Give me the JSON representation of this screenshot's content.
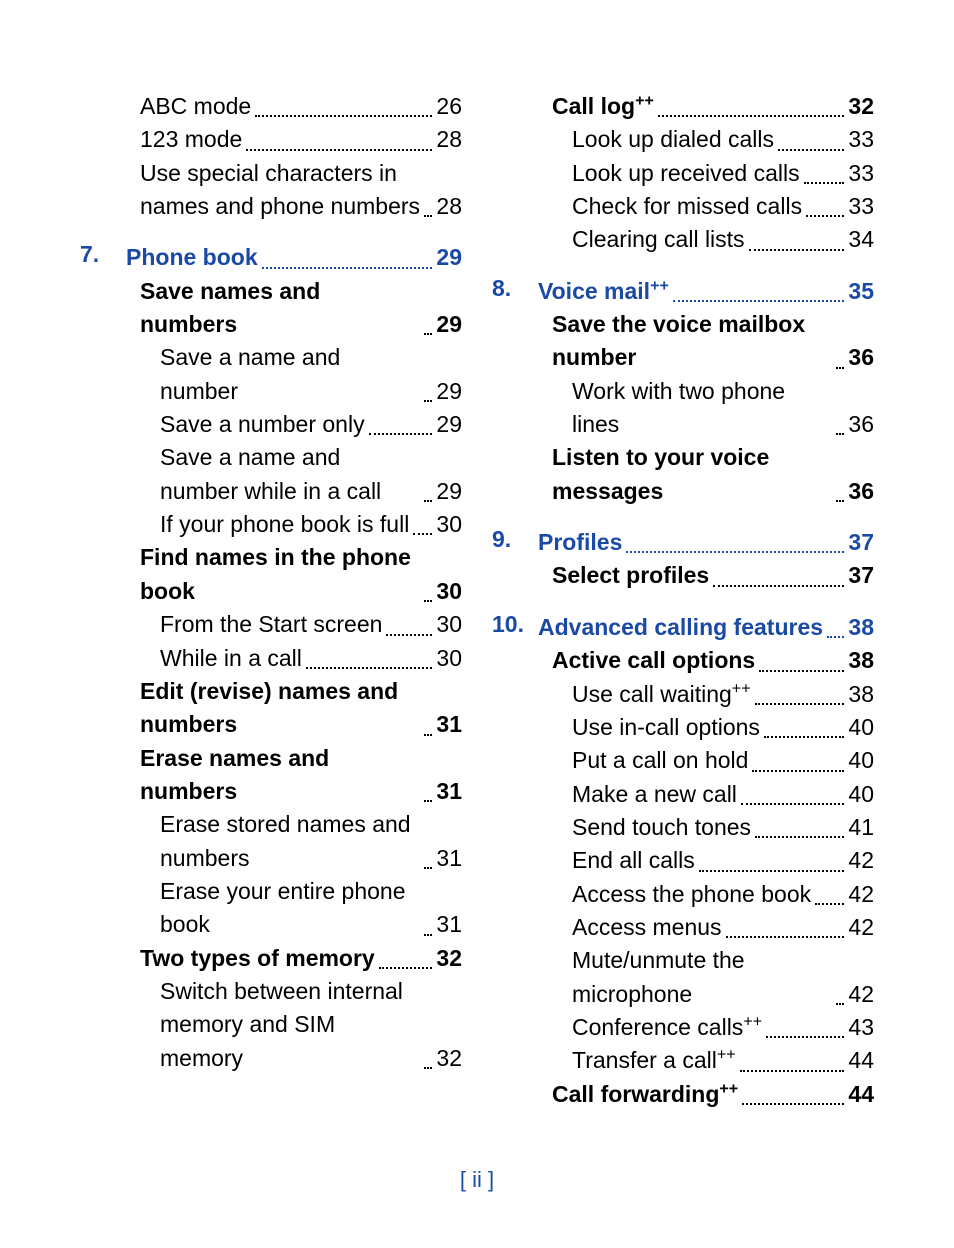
{
  "page_folio": "[ ii ]",
  "columns": [
    [
      {
        "level": 1,
        "style": "plain",
        "text": "ABC mode",
        "page": "26"
      },
      {
        "level": 1,
        "style": "plain",
        "text": "123 mode",
        "page": "28"
      },
      {
        "level": 1,
        "style": "plain",
        "text": "Use special characters in names and phone numbers",
        "page": "28"
      },
      {
        "level": 0,
        "style": "chapter",
        "num": "7.",
        "text": "Phone book",
        "page": "29"
      },
      {
        "level": 1,
        "style": "bold",
        "text": "Save names and numbers",
        "page": "29"
      },
      {
        "level": 2,
        "style": "plain",
        "text": "Save a name and number",
        "page": "29"
      },
      {
        "level": 2,
        "style": "plain",
        "text": "Save a number only",
        "page": "29"
      },
      {
        "level": 2,
        "style": "plain",
        "text": "Save a name and number while in a call",
        "page": "29"
      },
      {
        "level": 2,
        "style": "plain",
        "text": "If your phone book is full",
        "page": "30"
      },
      {
        "level": 1,
        "style": "bold",
        "text": "Find names in the phone book",
        "page": "30"
      },
      {
        "level": 2,
        "style": "plain",
        "text": "From the Start screen",
        "page": "30"
      },
      {
        "level": 2,
        "style": "plain",
        "text": "While in a call",
        "page": "30"
      },
      {
        "level": 1,
        "style": "bold",
        "text": "Edit (revise) names and numbers",
        "page": "31"
      },
      {
        "level": 1,
        "style": "bold",
        "text": "Erase names and numbers",
        "page": "31"
      },
      {
        "level": 2,
        "style": "plain",
        "text": "Erase stored names and numbers",
        "page": "31"
      },
      {
        "level": 2,
        "style": "plain",
        "text": "Erase your entire phone book",
        "page": "31"
      },
      {
        "level": 1,
        "style": "bold",
        "text": "Two types of memory",
        "page": "32"
      },
      {
        "level": 2,
        "style": "plain",
        "text": "Switch between internal memory and SIM memory",
        "page": "32"
      }
    ],
    [
      {
        "level": 1,
        "style": "bold",
        "text": "Call log",
        "sup": "++",
        "page": "32"
      },
      {
        "level": 2,
        "style": "plain",
        "text": "Look up dialed calls",
        "page": "33"
      },
      {
        "level": 2,
        "style": "plain",
        "text": "Look up received calls",
        "page": "33"
      },
      {
        "level": 2,
        "style": "plain",
        "text": "Check for missed calls",
        "page": "33"
      },
      {
        "level": 2,
        "style": "plain",
        "text": "Clearing call lists",
        "page": "34"
      },
      {
        "level": 0,
        "style": "chapter",
        "num": "8.",
        "text": "Voice mail",
        "sup": "++",
        "page": "35"
      },
      {
        "level": 1,
        "style": "bold",
        "text": "Save the voice mailbox number",
        "page": "36"
      },
      {
        "level": 2,
        "style": "plain",
        "text": "Work with two phone lines",
        "page": "36"
      },
      {
        "level": 1,
        "style": "bold",
        "text": "Listen to your voice messages",
        "page": "36"
      },
      {
        "level": 0,
        "style": "chapter",
        "num": "9.",
        "text": "Profiles",
        "page": "37"
      },
      {
        "level": 1,
        "style": "bold",
        "text": "Select profiles",
        "page": "37"
      },
      {
        "level": 0,
        "style": "chapter",
        "num": "10.",
        "text": "Advanced calling features",
        "page": "38"
      },
      {
        "level": 1,
        "style": "bold",
        "text": "Active call options",
        "page": "38"
      },
      {
        "level": 2,
        "style": "plain",
        "text": "Use call waiting",
        "sup": "++",
        "page": "38"
      },
      {
        "level": 2,
        "style": "plain",
        "text": "Use in-call options",
        "page": "40"
      },
      {
        "level": 2,
        "style": "plain",
        "text": "Put a call on hold",
        "page": "40"
      },
      {
        "level": 2,
        "style": "plain",
        "text": "Make a new call",
        "page": "40"
      },
      {
        "level": 2,
        "style": "plain",
        "text": "Send touch tones",
        "page": "41"
      },
      {
        "level": 2,
        "style": "plain",
        "text": "End all calls",
        "page": "42"
      },
      {
        "level": 2,
        "style": "plain",
        "text": "Access the phone book",
        "page": "42"
      },
      {
        "level": 2,
        "style": "plain",
        "text": "Access menus",
        "page": "42"
      },
      {
        "level": 2,
        "style": "plain",
        "text": "Mute/unmute the  microphone",
        "page": "42"
      },
      {
        "level": 2,
        "style": "plain",
        "text": "Conference calls",
        "sup": "++",
        "page": "43"
      },
      {
        "level": 2,
        "style": "plain",
        "text": "Transfer a call",
        "sup": "++",
        "page": "44"
      },
      {
        "level": 1,
        "style": "bold",
        "text": "Call forwarding",
        "sup": "++",
        "page": "44"
      }
    ]
  ]
}
